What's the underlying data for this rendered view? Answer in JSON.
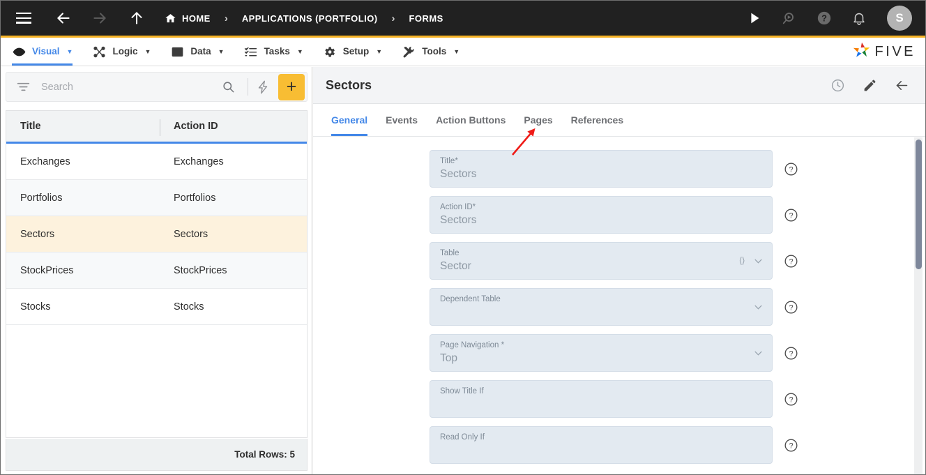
{
  "topbar": {
    "menu_icon": "hamburger-icon",
    "back_icon": "arrow-left-icon",
    "forward_icon": "arrow-right-icon",
    "up_icon": "arrow-up-icon",
    "breadcrumbs": [
      {
        "label": "HOME",
        "icon": "home-icon"
      },
      {
        "label": "APPLICATIONS (PORTFOLIO)"
      },
      {
        "label": "FORMS"
      }
    ],
    "separator": "›",
    "actions": [
      {
        "name": "run-icon"
      },
      {
        "name": "search-debug-icon"
      },
      {
        "name": "help-icon"
      },
      {
        "name": "notifications-icon"
      }
    ],
    "avatar_initial": "S",
    "accent_color": "#f5b225",
    "bg_color": "#212121"
  },
  "menubar": {
    "items": [
      {
        "label": "Visual",
        "icon": "eye-icon",
        "active": true
      },
      {
        "label": "Logic",
        "icon": "logic-nodes-icon",
        "active": false
      },
      {
        "label": "Data",
        "icon": "table-grid-icon",
        "active": false
      },
      {
        "label": "Tasks",
        "icon": "checklist-icon",
        "active": false
      },
      {
        "label": "Setup",
        "icon": "gear-icon",
        "active": false
      },
      {
        "label": "Tools",
        "icon": "tools-icon",
        "active": false
      }
    ],
    "caret": "▼",
    "brand": "FIVE",
    "active_color": "#4488e8"
  },
  "sidebar": {
    "search": {
      "placeholder": "Search",
      "value": ""
    },
    "filter_icon": "filter-icon",
    "search_icon": "search-icon",
    "bolt_icon": "lightning-bolt-icon",
    "add_label": "+",
    "grid": {
      "columns": [
        "Title",
        "Action ID"
      ],
      "rows": [
        {
          "title": "Exchanges",
          "action_id": "Exchanges",
          "selected": false
        },
        {
          "title": "Portfolios",
          "action_id": "Portfolios",
          "selected": false
        },
        {
          "title": "Sectors",
          "action_id": "Sectors",
          "selected": true
        },
        {
          "title": "StockPrices",
          "action_id": "StockPrices",
          "selected": false
        },
        {
          "title": "Stocks",
          "action_id": "Stocks",
          "selected": false
        }
      ],
      "footer": "Total Rows: 5",
      "selected_row_color": "#fdf2dd",
      "header_underline_color": "#4488e8"
    }
  },
  "detail": {
    "title": "Sectors",
    "header_actions": [
      {
        "name": "history-clock-icon"
      },
      {
        "name": "edit-pencil-icon"
      },
      {
        "name": "back-arrow-icon"
      }
    ],
    "tabs": [
      {
        "label": "General",
        "active": true
      },
      {
        "label": "Events",
        "active": false
      },
      {
        "label": "Action Buttons",
        "active": false
      },
      {
        "label": "Pages",
        "active": false
      },
      {
        "label": "References",
        "active": false
      }
    ],
    "fields": [
      {
        "label": "Title",
        "required": true,
        "value": "Sectors",
        "adorn": "none"
      },
      {
        "label": "Action ID",
        "required": true,
        "value": "Sectors",
        "adorn": "none"
      },
      {
        "label": "Table",
        "required": false,
        "value": "Sector",
        "adorn": "code-chevron"
      },
      {
        "label": "Dependent Table",
        "required": false,
        "value": "",
        "adorn": "chevron"
      },
      {
        "label": "Page Navigation",
        "required": true,
        "value": "Top",
        "adorn": "chevron"
      },
      {
        "label": "Show Title If",
        "required": false,
        "value": "",
        "adorn": "none"
      },
      {
        "label": "Read Only If",
        "required": false,
        "value": "",
        "adorn": "none"
      }
    ],
    "help_icon": "help-circle-icon",
    "required_marker": "*",
    "field_bg_color": "#e3eaf1"
  },
  "annotation": {
    "arrow": {
      "name": "red-pointer-arrow",
      "color": "#ef1b17",
      "points_to": "Pages"
    }
  }
}
